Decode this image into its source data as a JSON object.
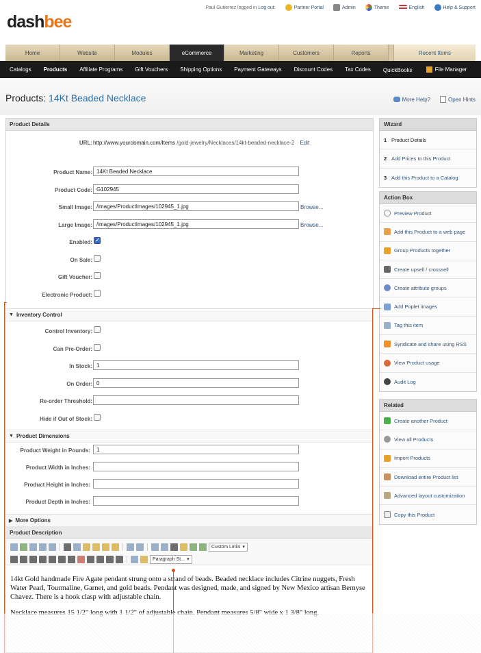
{
  "topbar": {
    "user_text": "Paul Gutierrez logged in",
    "logout": "Log out.",
    "links": [
      "Partner Portal",
      "Admin",
      "Theme",
      "English",
      "Help & Support"
    ]
  },
  "logo": {
    "part1": "dash",
    "part2": "bee"
  },
  "nav": {
    "tabs": [
      "Home",
      "Website",
      "Modules",
      "eCommerce",
      "Marketing",
      "Customers",
      "Reports"
    ],
    "active": "eCommerce",
    "recent": "Recent Items"
  },
  "subnav": {
    "items": [
      "Catalogs",
      "Products",
      "Affiliate Programs",
      "Gift Vouchers",
      "Shipping Options",
      "Payment Gateways",
      "Discount Codes",
      "Tax Codes",
      "QuickBooks",
      "File Manager"
    ],
    "active": "Products"
  },
  "page": {
    "title_prefix": "Products:",
    "title_value": "14Kt Beaded Necklace",
    "more_help": "More Help?",
    "open_hints": "Open Hints"
  },
  "product_details": {
    "heading": "Product Details",
    "url_label": "URL:",
    "url_domain": "http://www.yourdomain.com/Items",
    "url_path": "/gold-jewelry/Necklaces/14kt-beaded-necklace-2",
    "url_edit": "Edit",
    "name_label": "Product Name:",
    "name_value": "14Kt Beaded Necklace",
    "code_label": "Product Code:",
    "code_value": "G102945",
    "small_label": "Small Image:",
    "small_value": "/images/ProductImages/102945_1.jpg",
    "large_label": "Large Image:",
    "large_value": "/images/ProductImages/102945_1.jpg",
    "browse": "Browse...",
    "enabled_label": "Enabled:",
    "onsale_label": "On Sale:",
    "gift_label": "Gift Voucher:",
    "electronic_label": "Electronic Product:"
  },
  "inventory": {
    "heading": "Inventory Control",
    "control_label": "Control Inventory:",
    "preorder_label": "Can Pre-Order:",
    "instock_label": "In Stock:",
    "instock_value": "1",
    "onorder_label": "On Order:",
    "onorder_value": "0",
    "reorder_label": "Re-order Threshold:",
    "hide_label": "Hide if Out of Stock:"
  },
  "dimensions": {
    "heading": "Product Dimensions",
    "weight_label": "Product Weight in Pounds:",
    "weight_value": "1",
    "width_label": "Product Width in Inches:",
    "height_label": "Product Height in Inches:",
    "depth_label": "Product Depth in Inches:"
  },
  "more_options": "More Options",
  "description": {
    "heading": "Product Description",
    "custom_links": "Custom Links",
    "paragraph_style": "Paragraph St...",
    "para1": "14kt Gold handmade Fire Agate pendant strung onto a strand of beads. Beaded necklace includes Citrine nuggets, Fresh Water Pearl, Tourmaline, Garnet, and gold beads. Pendant was designed, made, and signed by New Mexico artisan Bernyse Chavez. There is a hook clasp with adjustable chain.",
    "para2": "Necklace measures 15 1/2\" long with 1 1/2\" of adjustable chain. Pendant measures 5/8\" wide x 1 3/8\" long."
  },
  "wizard": {
    "heading": "Wizard",
    "steps": [
      {
        "num": "1",
        "label": "Product Details"
      },
      {
        "num": "2",
        "label": "Add Prices to this Product"
      },
      {
        "num": "3",
        "label": "Add this Product to a Catalog"
      }
    ]
  },
  "action_box": {
    "heading": "Action Box",
    "items": [
      "Preview Product",
      "Add this Product to a web page",
      "Group Products together",
      "Create upsell / crosssell",
      "Create attribute groups",
      "Add Poplet images",
      "Tag this item",
      "Syndicate and share using RSS",
      "View Product usage",
      "Audit Log"
    ]
  },
  "related": {
    "heading": "Related",
    "items": [
      "Create another Product",
      "View all Products",
      "Import Products",
      "Download entire Product list",
      "Advanced layout customization",
      "Copy this Product"
    ]
  },
  "colors": {
    "accent": "#e8761a",
    "link": "#2b6ea3",
    "nav_dark": "#1a1a1a",
    "callout": "#d8541e"
  }
}
